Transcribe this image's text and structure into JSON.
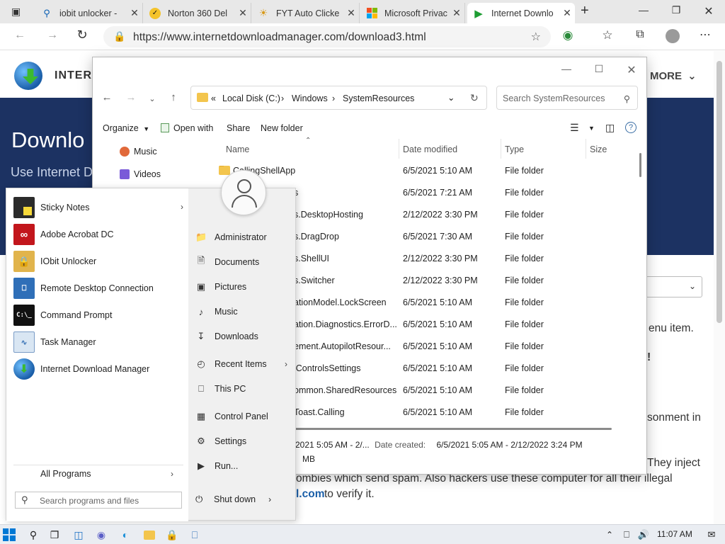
{
  "browser": {
    "tabs": [
      {
        "label": "iobit unlocker -",
        "icon": "search-icon"
      },
      {
        "label": "Norton 360 Del",
        "icon": "norton-icon"
      },
      {
        "label": "FYT Auto Clicke",
        "icon": "sun-icon"
      },
      {
        "label": "Microsoft Privac",
        "icon": "microsoft-icon"
      },
      {
        "label": "Internet Downlo",
        "icon": "play-icon"
      }
    ],
    "url": "https://www.internetdownloadmanager.com/download3.html"
  },
  "website": {
    "brand": "INTERN",
    "more": "MORE",
    "banner_title": "Downlo",
    "banner_subtitle": "Use Internet D",
    "article_lines": [
      "enu item.",
      "!",
      "sonment in",
      "They inject",
      "ombies which send spam. Also hackers use these computer for all their illegal",
      "l.com",
      "to verify it."
    ]
  },
  "explorer": {
    "breadcrumb": [
      "Local Disk (C:)",
      "Windows",
      "SystemResources"
    ],
    "search_placeholder": "Search SystemResources",
    "toolbar": {
      "organize": "Organize",
      "open_with": "Open with",
      "share": "Share",
      "new_folder": "New folder"
    },
    "nav_items": [
      "Music",
      "Videos"
    ],
    "columns": {
      "name": "Name",
      "date": "Date modified",
      "type": "Type",
      "size": "Size"
    },
    "files": [
      {
        "name": "CallingShellApp",
        "date": "6/5/2021 5:10 AM",
        "type": "File folder"
      },
      {
        "name": "s",
        "date": "6/5/2021 7:21 AM",
        "type": "File folder"
      },
      {
        "name": "s.DesktopHosting",
        "date": "2/12/2022 3:30 PM",
        "type": "File folder"
      },
      {
        "name": "s.DragDrop",
        "date": "6/5/2021 7:30 AM",
        "type": "File folder"
      },
      {
        "name": "s.ShellUI",
        "date": "2/12/2022 3:30 PM",
        "type": "File folder"
      },
      {
        "name": "s.Switcher",
        "date": "2/12/2022 3:30 PM",
        "type": "File folder"
      },
      {
        "name": "ationModel.LockScreen",
        "date": "6/5/2021 5:10 AM",
        "type": "File folder"
      },
      {
        "name": "ation.Diagnostics.ErrorD...",
        "date": "6/5/2021 5:10 AM",
        "type": "File folder"
      },
      {
        "name": "ement.AutopilotResour...",
        "date": "6/5/2021 5:10 AM",
        "type": "File folder"
      },
      {
        "name": "lControlsSettings",
        "date": "6/5/2021 5:10 AM",
        "type": "File folder"
      },
      {
        "name": "ommon.SharedResources",
        "date": "6/5/2021 5:10 AM",
        "type": "File folder"
      },
      {
        "name": "Toast.Calling",
        "date": "6/5/2021 5:10 AM",
        "type": "File folder"
      }
    ],
    "details_line1_a": "2021 5:05 AM - 2/...",
    "details_line1_b": "Date created:",
    "details_line1_c": "6/5/2021 5:05 AM - 2/12/2022 3:24 PM",
    "details_line2": "MB"
  },
  "start_menu": {
    "apps": [
      {
        "label": "Sticky Notes",
        "has_arrow": true
      },
      {
        "label": "Adobe Acrobat DC"
      },
      {
        "label": "IObit Unlocker"
      },
      {
        "label": "Remote Desktop Connection"
      },
      {
        "label": "Command Prompt"
      },
      {
        "label": "Task Manager"
      },
      {
        "label": "Internet Download Manager"
      }
    ],
    "all_programs": "All Programs",
    "search_placeholder": "Search programs and files",
    "right_items": [
      {
        "label": "Administrator",
        "icon": "user-folder-icon"
      },
      {
        "label": "Documents",
        "icon": "document-icon"
      },
      {
        "label": "Pictures",
        "icon": "picture-icon"
      },
      {
        "label": "Music",
        "icon": "music-icon"
      },
      {
        "label": "Downloads",
        "icon": "download-icon"
      },
      {
        "label": "Recent Items",
        "icon": "recent-icon"
      },
      {
        "label": "This PC",
        "icon": "computer-icon"
      },
      {
        "label": "Control Panel",
        "icon": "control-panel-icon"
      },
      {
        "label": "Settings",
        "icon": "gear-icon"
      },
      {
        "label": "Run...",
        "icon": "run-icon"
      }
    ],
    "shutdown": "Shut down"
  },
  "taskbar": {
    "time": "11:07 AM"
  },
  "colors": {
    "banner": "#1c3262",
    "accent_blue": "#0067c0",
    "folder": "#f3c54d"
  }
}
